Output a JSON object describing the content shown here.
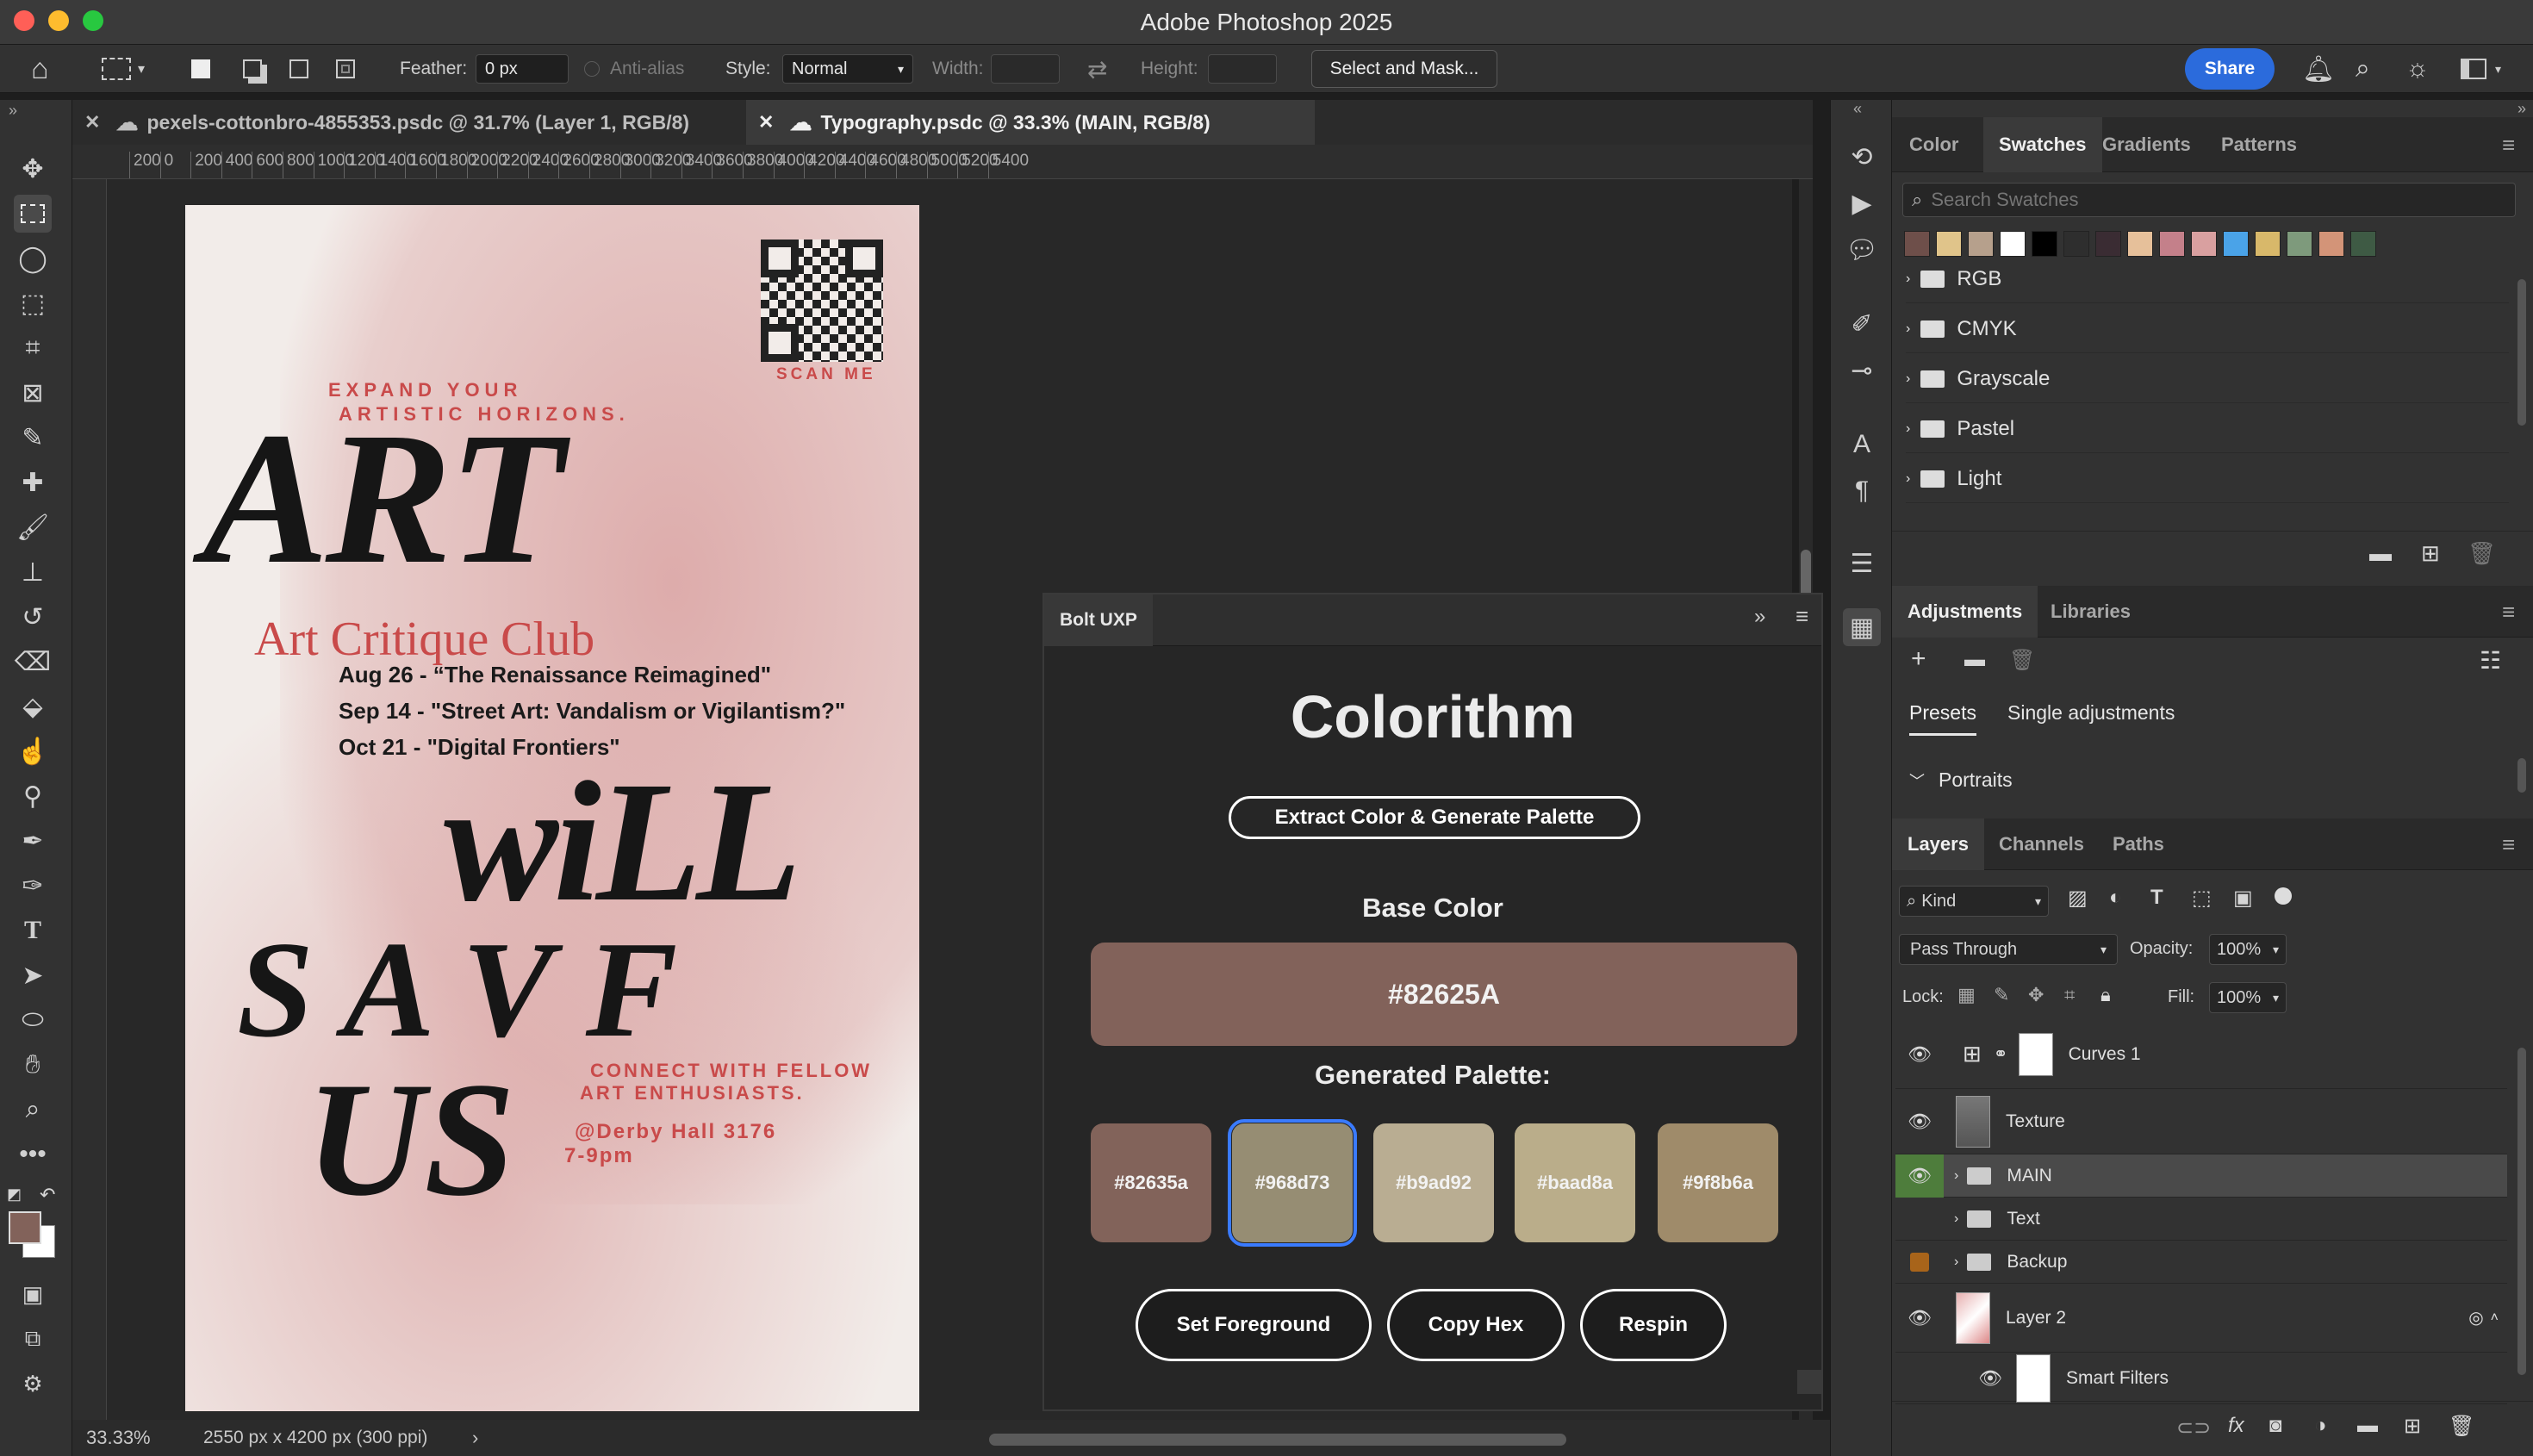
{
  "app": {
    "title": "Adobe Photoshop 2025"
  },
  "options": {
    "feather_label": "Feather:",
    "feather_value": "0 px",
    "antialias_label": "Anti-alias",
    "style_label": "Style:",
    "style_value": "Normal",
    "width_label": "Width:",
    "height_label": "Height:",
    "select_mask": "Select and Mask...",
    "share": "Share"
  },
  "tabs": [
    {
      "label": "pexels-cottonbro-4855353.psdc @ 31.7% (Layer 1, RGB/8)"
    },
    {
      "label": "Typography.psdc @ 33.3% (MAIN, RGB/8)"
    }
  ],
  "ruler": {
    "top_ticks": [
      "200",
      "0",
      "200",
      "400",
      "600",
      "800",
      "1000",
      "1200",
      "1400",
      "1600",
      "1800",
      "2000",
      "2200",
      "2400",
      "2600",
      "2800",
      "3000",
      "3200",
      "3400",
      "3600",
      "3800",
      "4000",
      "4200",
      "4400",
      "4600",
      "4800",
      "5000",
      "5200",
      "5400"
    ]
  },
  "poster": {
    "tagline1": "EXPAND YOUR",
    "tagline2": "ARTISTIC HORIZONS.",
    "art": "ART",
    "club": "Art Critique Club",
    "events": [
      "Aug 26 - “The Renaissance Reimagined\"",
      "Sep 14 - \"Street Art: Vandalism or Vigilantism?\"",
      "Oct 21 - \"Digital Frontiers\""
    ],
    "will": "wiLL",
    "save": "S A V F",
    "us": "US",
    "connect1": "CONNECT WITH FELLOW",
    "connect2": "ART ENTHUSIASTS.",
    "location": "@Derby Hall 3176",
    "time": "7-9pm",
    "scan": "SCAN ME"
  },
  "status": {
    "zoom": "33.33%",
    "doc_info": "2550 px x 4200 px (300 ppi)"
  },
  "bolt": {
    "title": "Bolt UXP",
    "app_name": "Colorithm",
    "extract_btn": "Extract Color & Generate Palette",
    "base_label": "Base Color",
    "base_hex": "#82625A",
    "palette_label": "Generated Palette:",
    "palette": [
      {
        "hex": "#82635a",
        "color": "#82635a"
      },
      {
        "hex": "#968d73",
        "color": "#968d73"
      },
      {
        "hex": "#b9ad92",
        "color": "#b9ad92"
      },
      {
        "hex": "#baad8a",
        "color": "#baad8a"
      },
      {
        "hex": "#9f8b6a",
        "color": "#9f8b6a"
      }
    ],
    "set_fg": "Set Foreground",
    "copy_hex": "Copy Hex",
    "respin": "Respin"
  },
  "swatches_panel": {
    "tabs": [
      "Color",
      "Swatches",
      "Gradients",
      "Patterns"
    ],
    "search_placeholder": "Search Swatches",
    "colors": [
      "#6e4f4a",
      "#e0c48a",
      "#b6a08c",
      "#ffffff",
      "#000000",
      "#2e2e2e",
      "#3a2c33",
      "#e6c09a",
      "#c4808a",
      "#d9a0a0",
      "#4aa3e8",
      "#d8b86a",
      "#7e9a7c",
      "#d39478",
      "#3e5a44"
    ],
    "folders": [
      "RGB",
      "CMYK",
      "Grayscale",
      "Pastel",
      "Light"
    ]
  },
  "adjustments_panel": {
    "tabs": [
      "Adjustments",
      "Libraries"
    ],
    "subtabs": [
      "Presets",
      "Single adjustments"
    ],
    "section": "Portraits"
  },
  "layers_panel": {
    "tabs": [
      "Layers",
      "Channels",
      "Paths"
    ],
    "kind": "Kind",
    "blend": "Pass Through",
    "opacity_label": "Opacity:",
    "opacity": "100%",
    "lock_label": "Lock:",
    "fill_label": "Fill:",
    "fill": "100%",
    "layers": [
      {
        "name": "Curves 1"
      },
      {
        "name": "Texture"
      },
      {
        "name": "MAIN"
      },
      {
        "name": "Text"
      },
      {
        "name": "Backup"
      },
      {
        "name": "Layer 2"
      },
      {
        "name": "Smart Filters"
      }
    ]
  }
}
